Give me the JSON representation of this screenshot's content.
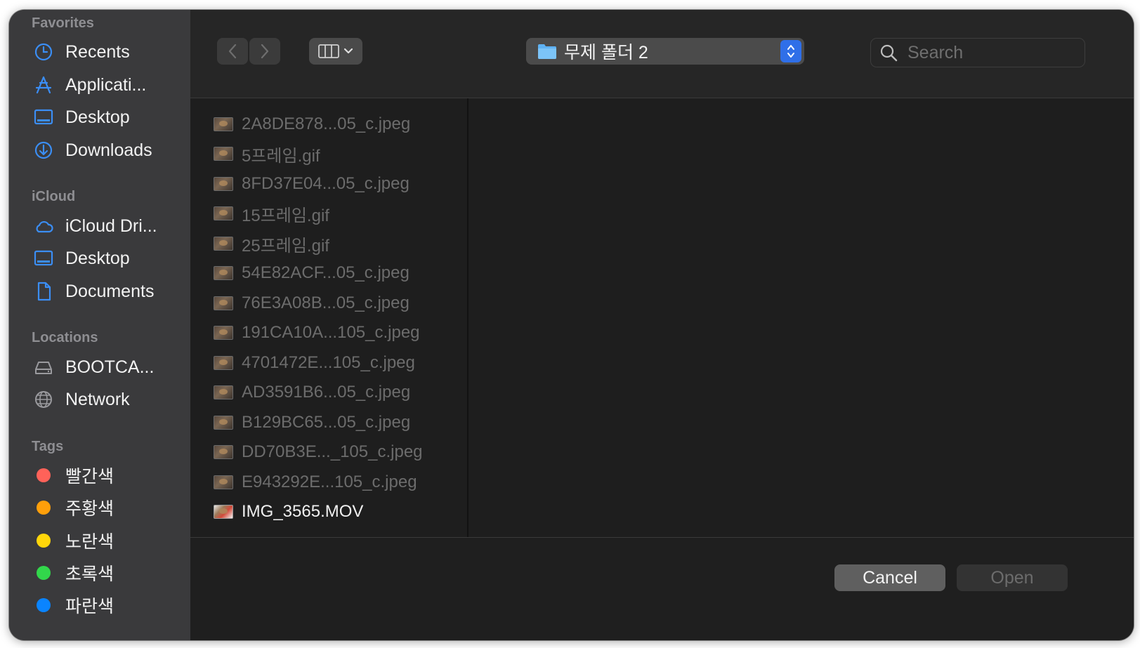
{
  "sidebar": {
    "favorites_heading": "Favorites",
    "favorites": [
      {
        "label": "Recents",
        "icon": "clock-icon"
      },
      {
        "label": "Applicati...",
        "icon": "applications-icon"
      },
      {
        "label": "Desktop",
        "icon": "desktop-icon"
      },
      {
        "label": "Downloads",
        "icon": "download-icon"
      }
    ],
    "icloud_heading": "iCloud",
    "icloud": [
      {
        "label": "iCloud Dri...",
        "icon": "cloud-icon"
      },
      {
        "label": "Desktop",
        "icon": "desktop-icon"
      },
      {
        "label": "Documents",
        "icon": "document-icon"
      }
    ],
    "locations_heading": "Locations",
    "locations": [
      {
        "label": "BOOTCA...",
        "icon": "drive-icon"
      },
      {
        "label": "Network",
        "icon": "globe-icon"
      }
    ],
    "tags_heading": "Tags",
    "tags": [
      {
        "label": "빨간색",
        "color": "#ff6259"
      },
      {
        "label": "주황색",
        "color": "#ff9f0a"
      },
      {
        "label": "노란색",
        "color": "#ffd60a"
      },
      {
        "label": "초록색",
        "color": "#32d74b"
      },
      {
        "label": "파란색",
        "color": "#0a84ff"
      }
    ]
  },
  "toolbar": {
    "back_icon": "chevron-left-icon",
    "forward_icon": "chevron-right-icon",
    "view_icon": "column-view-icon",
    "path_folder": "무제 폴더 2",
    "search_placeholder": "Search"
  },
  "files": [
    {
      "name": "2A8DE878...05_c.jpeg",
      "enabled": false
    },
    {
      "name": "5프레임.gif",
      "enabled": false
    },
    {
      "name": "8FD37E04...05_c.jpeg",
      "enabled": false
    },
    {
      "name": "15프레임.gif",
      "enabled": false
    },
    {
      "name": "25프레임.gif",
      "enabled": false
    },
    {
      "name": "54E82ACF...05_c.jpeg",
      "enabled": false
    },
    {
      "name": "76E3A08B...05_c.jpeg",
      "enabled": false
    },
    {
      "name": "191CA10A...105_c.jpeg",
      "enabled": false
    },
    {
      "name": "4701472E...105_c.jpeg",
      "enabled": false
    },
    {
      "name": "AD3591B6...05_c.jpeg",
      "enabled": false
    },
    {
      "name": "B129BC65...05_c.jpeg",
      "enabled": false
    },
    {
      "name": "DD70B3E..._105_c.jpeg",
      "enabled": false
    },
    {
      "name": "E943292E...105_c.jpeg",
      "enabled": false
    },
    {
      "name": "IMG_3565.MOV",
      "enabled": true
    }
  ],
  "footer": {
    "cancel_label": "Cancel",
    "open_label": "Open"
  },
  "colors": {
    "accent": "#2f6fe8",
    "sidebar_icon": "#3b8ef5"
  }
}
